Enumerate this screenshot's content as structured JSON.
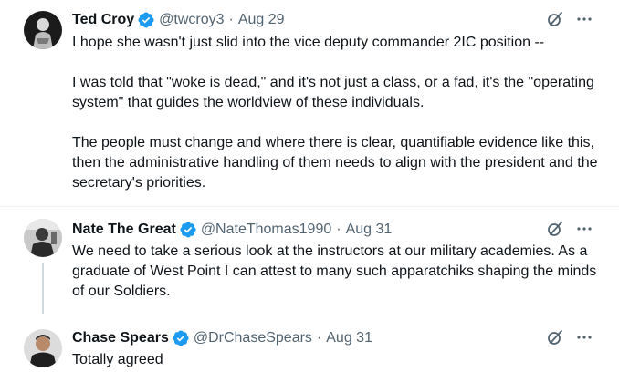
{
  "posts": [
    {
      "name": "Ted Croy",
      "handle": "@twcroy3",
      "time": "Aug 29",
      "paragraphs": [
        "I hope she wasn't just slid into the vice deputy commander 2IC position --",
        "I was told that \"woke is dead,\" and it's not just a class, or a fad, it's the \"operating system\" that guides the worldview of these individuals.",
        "The people must change and where there is clear, quantifiable evidence like this, then the administrative handling of them needs to align with the president and the secretary's priorities."
      ]
    },
    {
      "name": "Nate The Great",
      "handle": "@NateThomas1990",
      "time": "Aug 31",
      "paragraphs": [
        "We need to take a serious look at the instructors at our military academies. As a graduate of West Point I can attest to many such apparatchiks shaping the minds of our Soldiers."
      ]
    },
    {
      "name": "Chase Spears",
      "handle": "@DrChaseSpears",
      "time": "Aug 31",
      "paragraphs": [
        "Totally agreed"
      ]
    }
  ],
  "separator": "·",
  "icons": {
    "verified": "verified-badge-icon",
    "grok": "grok-icon",
    "more": "more-icon"
  },
  "colors": {
    "verified": "#1d9bf0",
    "secondary_text": "#536471",
    "thread_line": "#cfd9de",
    "divider": "#eff3f4"
  }
}
